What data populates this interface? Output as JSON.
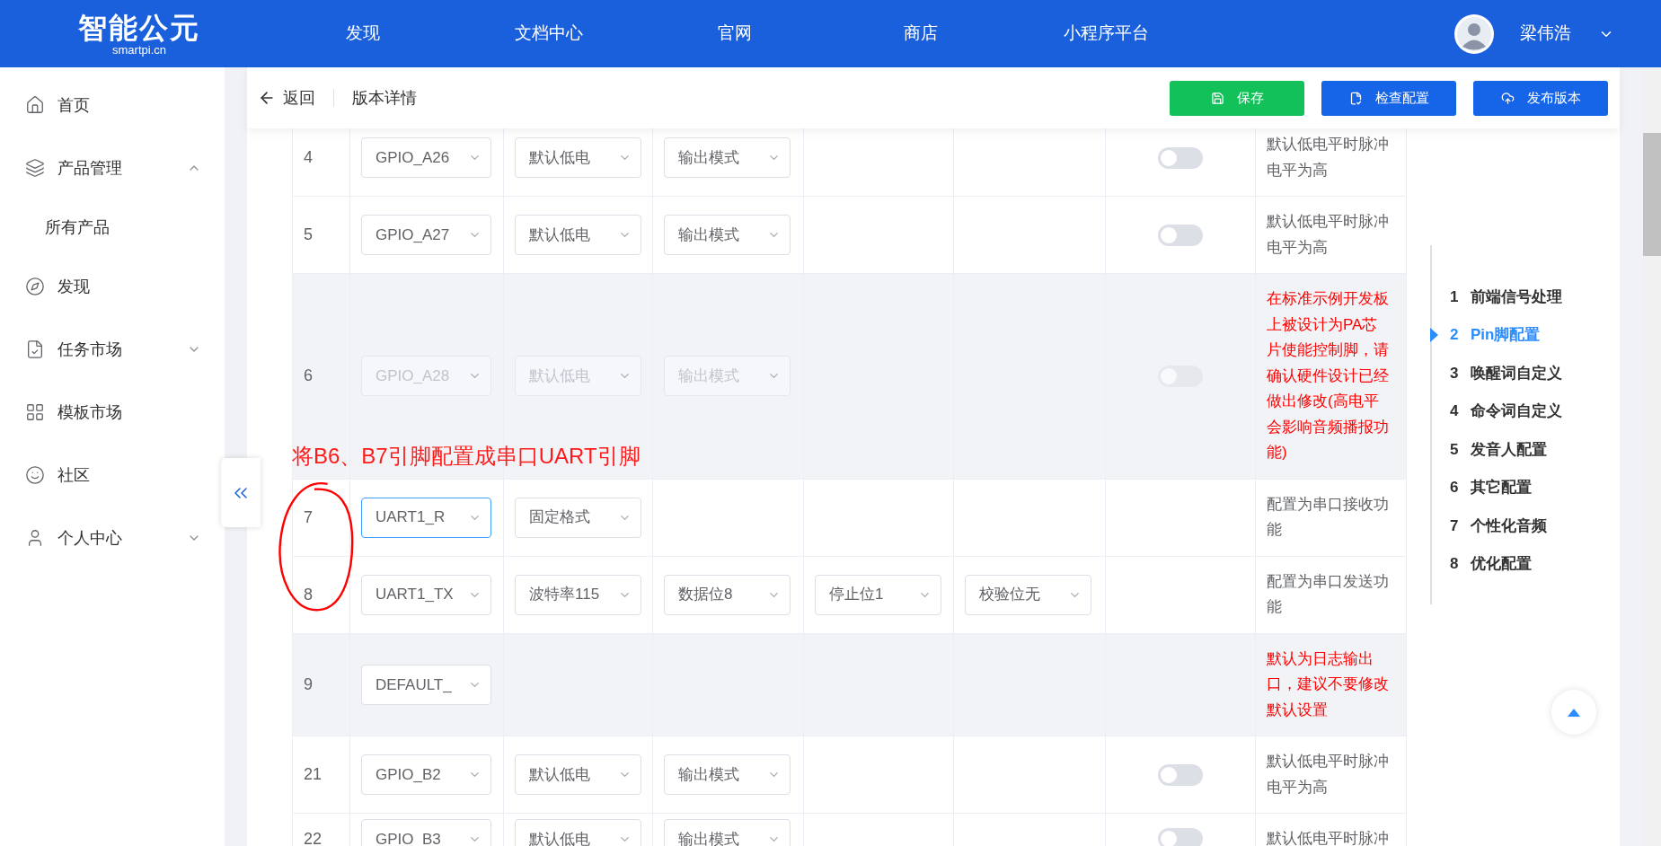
{
  "header": {
    "logo": "智能公元",
    "logo_sub": "smartpi.cn",
    "nav": [
      "发现",
      "文档中心",
      "官网",
      "商店",
      "小程序平台"
    ],
    "user": "梁伟浩"
  },
  "sidebar": {
    "items": [
      {
        "label": "首页"
      },
      {
        "label": "产品管理",
        "expanded": true,
        "children": [
          {
            "label": "所有产品"
          }
        ]
      },
      {
        "label": "发现"
      },
      {
        "label": "任务市场",
        "expanded": false
      },
      {
        "label": "模板市场"
      },
      {
        "label": "社区"
      },
      {
        "label": "个人中心",
        "expanded": false
      }
    ]
  },
  "toolbar": {
    "back": "返回",
    "title": "版本详情",
    "buttons": [
      {
        "label": "保存",
        "kind": "save"
      },
      {
        "label": "检查配置",
        "kind": "check"
      },
      {
        "label": "发布版本",
        "kind": "publish"
      }
    ]
  },
  "rows": [
    {
      "index": "4",
      "pin": "GPIO_A26",
      "focused": false,
      "disabled": false,
      "shaded": false,
      "options": [
        "默认低电",
        "输出模式"
      ],
      "toggle": {
        "on": false
      },
      "note": "默认低电平时脉冲电平为高",
      "warning": false
    },
    {
      "index": "5",
      "pin": "GPIO_A27",
      "focused": false,
      "disabled": false,
      "shaded": false,
      "options": [
        "默认低电",
        "输出模式"
      ],
      "toggle": {
        "on": false
      },
      "note": "默认低电平时脉冲电平为高",
      "warning": false
    },
    {
      "index": "6",
      "pin": "GPIO_A28",
      "focused": false,
      "disabled": true,
      "shaded": true,
      "options": [
        "默认低电",
        "输出模式"
      ],
      "toggle": {
        "on": false
      },
      "note": "在标准示例开发板上被设计为PA芯片使能控制脚，请确认硬件设计已经做出修改(高电平会影响音频播报功能)",
      "warning": true
    },
    {
      "index": "7",
      "pin": "UART1_R",
      "focused": true,
      "disabled": false,
      "shaded": false,
      "options": [
        "固定格式"
      ],
      "note": "配置为串口接收功能",
      "warning": false
    },
    {
      "index": "8",
      "pin": "UART1_TX",
      "focused": false,
      "disabled": false,
      "shaded": false,
      "options": [
        "波特率115",
        "数据位8",
        "停止位1",
        "校验位无"
      ],
      "note": "配置为串口发送功能",
      "warning": false
    },
    {
      "index": "9",
      "pin": "DEFAULT_",
      "focused": false,
      "disabled": false,
      "shaded": true,
      "options": [],
      "note": "默认为日志输出口，建议不要修改默认设置",
      "warning": true
    },
    {
      "index": "21",
      "pin": "GPIO_B2",
      "focused": false,
      "disabled": false,
      "shaded": false,
      "options": [
        "默认低电",
        "输出模式"
      ],
      "toggle": {
        "on": false
      },
      "note": "默认低电平时脉冲电平为高",
      "warning": false
    },
    {
      "index": "22",
      "pin": "GPIO_B3",
      "focused": false,
      "disabled": false,
      "shaded": false,
      "options": [
        "默认低电",
        "输出模式"
      ],
      "toggle": {
        "on": false
      },
      "note": "默认低电平时脉冲",
      "warning": false
    }
  ],
  "annotation": {
    "text": "将B6、B7引脚配置成串口UART引脚"
  },
  "steps": [
    {
      "number": "1",
      "label": "前端信号处理",
      "selected": false
    },
    {
      "number": "2",
      "label": "Pin脚配置",
      "selected": true
    },
    {
      "number": "3",
      "label": "唤醒词自定义",
      "selected": false
    },
    {
      "number": "4",
      "label": "命令词自定义",
      "selected": false
    },
    {
      "number": "5",
      "label": "发音人配置",
      "selected": false
    },
    {
      "number": "6",
      "label": "其它配置",
      "selected": false
    },
    {
      "number": "7",
      "label": "个性化音频",
      "selected": false
    },
    {
      "number": "8",
      "label": "优化配置",
      "selected": false
    }
  ]
}
